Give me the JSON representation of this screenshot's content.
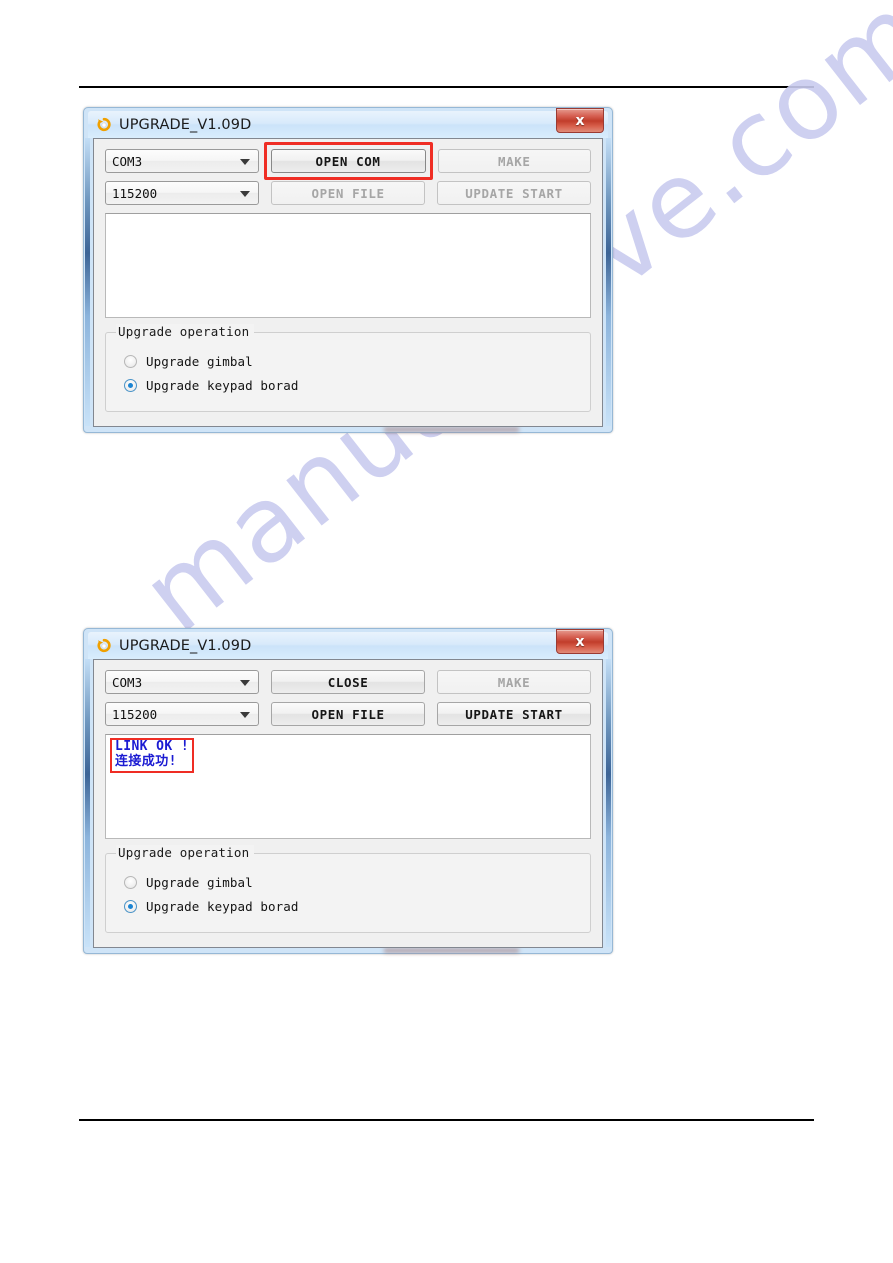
{
  "page": {
    "watermark": "manualshive.com",
    "rules": {
      "top": "horizontal-rule",
      "bottom": "horizontal-rule"
    }
  },
  "dialogs": [
    {
      "id": "dialog-before-connect",
      "title": "UPGRADE_V1.09D",
      "icon": "upgrade-refresh-icon",
      "close_label": "x",
      "port_combo": {
        "value": "COM3",
        "arrow": "chevron-down-icon"
      },
      "baud_combo": {
        "value": "115200",
        "arrow": "chevron-down-icon"
      },
      "buttons": {
        "open_com": {
          "label": "OPEN COM",
          "enabled": true,
          "highlighted": true
        },
        "make": {
          "label": "MAKE",
          "enabled": false,
          "highlighted": false
        },
        "open_file": {
          "label": "OPEN FILE",
          "enabled": false,
          "highlighted": false
        },
        "update_start": {
          "label": "UPDATE START",
          "enabled": false,
          "highlighted": false
        }
      },
      "log": {
        "lines": [],
        "highlighted": false
      },
      "group": {
        "title": "Upgrade operation",
        "options": [
          {
            "label": "Upgrade gimbal",
            "selected": false
          },
          {
            "label": "Upgrade keypad borad",
            "selected": true
          }
        ]
      }
    },
    {
      "id": "dialog-after-connect",
      "title": "UPGRADE_V1.09D",
      "icon": "upgrade-refresh-icon",
      "close_label": "x",
      "port_combo": {
        "value": "COM3",
        "arrow": "chevron-down-icon"
      },
      "baud_combo": {
        "value": "115200",
        "arrow": "chevron-down-icon"
      },
      "buttons": {
        "open_com": {
          "label": "CLOSE",
          "enabled": true,
          "highlighted": false
        },
        "make": {
          "label": "MAKE",
          "enabled": false,
          "highlighted": false
        },
        "open_file": {
          "label": "OPEN FILE",
          "enabled": true,
          "highlighted": false
        },
        "update_start": {
          "label": "UPDATE START",
          "enabled": true,
          "highlighted": false
        }
      },
      "log": {
        "lines": [
          "LINK OK !",
          "连接成功!"
        ],
        "highlighted": true
      },
      "group": {
        "title": "Upgrade operation",
        "options": [
          {
            "label": "Upgrade gimbal",
            "selected": false
          },
          {
            "label": "Upgrade keypad borad",
            "selected": true
          }
        ]
      }
    }
  ],
  "colors": {
    "highlight_red": "#ef2d24",
    "log_text_blue": "#1b1bd2",
    "radio_blue": "#1b84d2",
    "title_bar": "#d8eafb",
    "close_button": "#c13d2b",
    "watermark": "#c9cbef"
  }
}
